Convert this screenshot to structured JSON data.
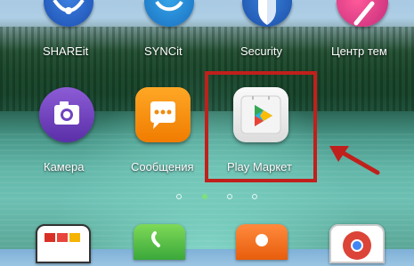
{
  "home_screen": {
    "top_row": [
      {
        "label": "SHAREit"
      },
      {
        "label": "SYNCit"
      },
      {
        "label": "Security"
      },
      {
        "label": "Центр тем"
      }
    ],
    "middle_row": [
      {
        "label": "Камера"
      },
      {
        "label": "Сообщения"
      },
      {
        "label": "Play Маркет"
      }
    ],
    "page_indicator": {
      "pages": 4,
      "active_page": 2
    }
  },
  "annotation": {
    "highlight_color": "#c0201c"
  }
}
